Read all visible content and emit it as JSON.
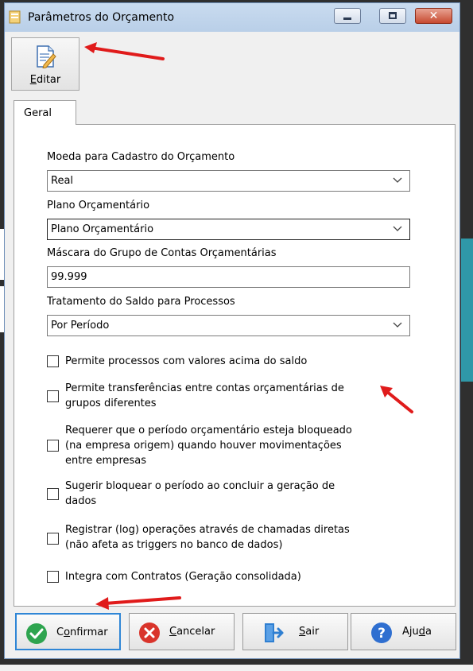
{
  "window": {
    "title": "Parâmetros do Orçamento",
    "close_glyph": "✕"
  },
  "toolbar": {
    "edit_label": "Editar",
    "edit_icon": "edit-document-icon"
  },
  "tabs": [
    {
      "label": "Geral",
      "selected": true
    }
  ],
  "fields": {
    "moeda": {
      "label": "Moeda para Cadastro do Orçamento",
      "value": "Real"
    },
    "plano": {
      "label": "Plano Orçamentário",
      "value": "Plano Orçamentário"
    },
    "mascara": {
      "label": "Máscara do Grupo de Contas Orçamentárias",
      "value": "99.999"
    },
    "tratamento": {
      "label": "Tratamento do Saldo para Processos",
      "value": "Por Período"
    }
  },
  "checkboxes": [
    {
      "lines": [
        "Permite processos com valores acima do saldo"
      ],
      "checked": false
    },
    {
      "lines": [
        "Permite transferências entre contas orçamentárias de",
        "grupos diferentes"
      ],
      "checked": false
    },
    {
      "lines": [
        "Requerer que o período orçamentário esteja bloqueado",
        "(na empresa origem) quando houver movimentações",
        "entre empresas"
      ],
      "checked": false
    },
    {
      "lines": [
        "Sugerir bloquear o período ao concluir a geração de",
        "dados"
      ],
      "checked": false
    },
    {
      "lines": [
        "Registrar (log) operações através de chamadas diretas",
        "(não afeta as triggers no banco de dados)"
      ],
      "checked": false
    },
    {
      "lines": [
        "Integra com Contratos (Geração consolidada)"
      ],
      "checked": false
    }
  ],
  "buttons": {
    "confirmar": {
      "label": "Confirmar",
      "icon": "check-circle-icon",
      "color": "#2ea44f"
    },
    "cancelar": {
      "label": "Cancelar",
      "icon": "x-circle-icon",
      "color": "#d9342b"
    },
    "sair": {
      "label": "Sair",
      "icon": "exit-door-icon",
      "color": "#2f7fd1"
    },
    "ajuda": {
      "label": "Ajuda",
      "icon": "help-circle-icon",
      "color": "#2f6fd0"
    }
  },
  "annotation_color": "#e01b1b"
}
